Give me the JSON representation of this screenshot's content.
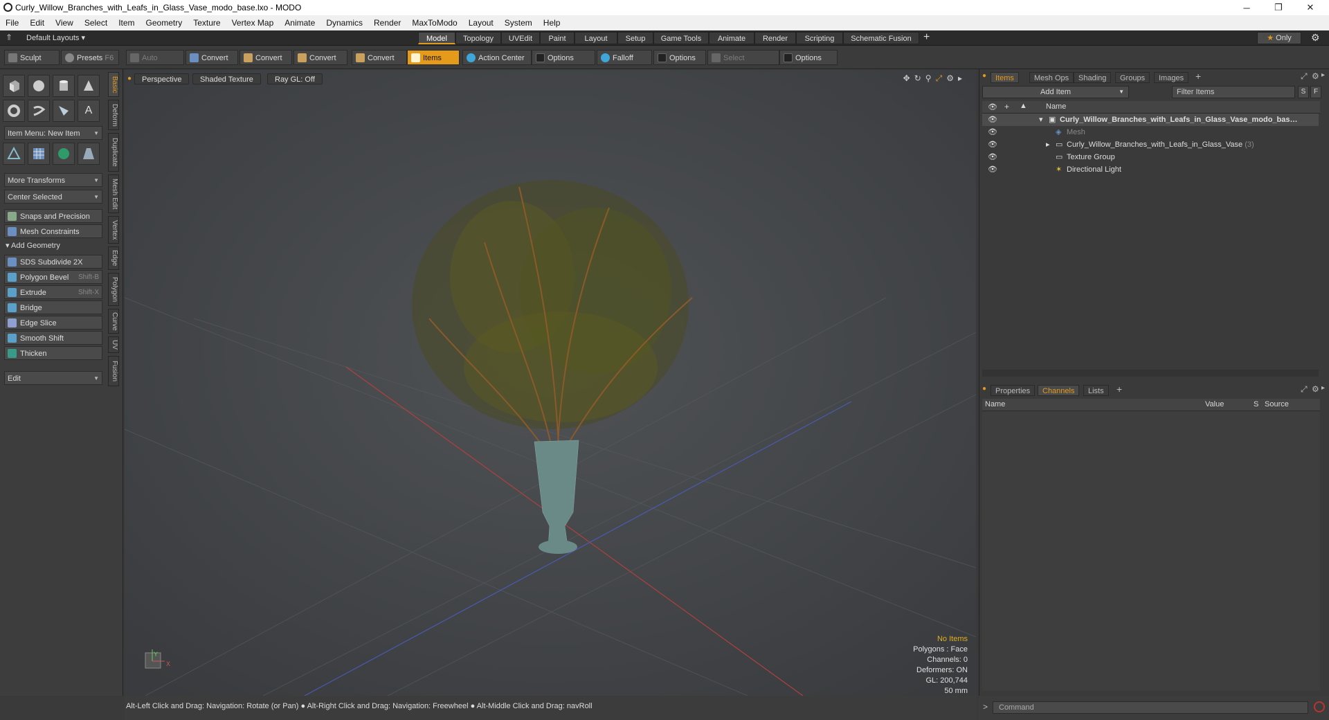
{
  "window": {
    "title": "Curly_Willow_Branches_with_Leafs_in_Glass_Vase_modo_base.lxo - MODO"
  },
  "menu": [
    "File",
    "Edit",
    "View",
    "Select",
    "Item",
    "Geometry",
    "Texture",
    "Vertex Map",
    "Animate",
    "Dynamics",
    "Render",
    "MaxToModo",
    "Layout",
    "System",
    "Help"
  ],
  "layout_selector": "Default Layouts",
  "mode_tabs": [
    "Model",
    "Topology",
    "UVEdit",
    "Paint",
    "Layout",
    "Setup",
    "Game Tools",
    "Animate",
    "Render",
    "Scripting",
    "Schematic Fusion"
  ],
  "mode_tab_active": "Model",
  "only_label": "Only",
  "toolbar": {
    "sculpt": "Sculpt",
    "presets": "Presets",
    "presets_key": "F6",
    "auto_select": "Auto Select",
    "convert1": "Convert",
    "convert2": "Convert",
    "convert3": "Convert",
    "convert4": "Convert",
    "items": "Items",
    "action_center": "Action Center",
    "options1": "Options",
    "falloff": "Falloff",
    "options2": "Options",
    "select_through": "Select Through",
    "options3": "Options"
  },
  "left_panel": {
    "item_menu": "Item Menu: New Item",
    "more_transforms": "More Transforms",
    "center_selected": "Center Selected",
    "snaps": "Snaps and Precision",
    "mesh_constraints": "Mesh Constraints",
    "add_geometry": "Add Geometry",
    "tools": [
      {
        "label": "SDS Subdivide 2X",
        "shortcut": ""
      },
      {
        "label": "Polygon Bevel",
        "shortcut": "Shift-B"
      },
      {
        "label": "Extrude",
        "shortcut": "Shift-X"
      },
      {
        "label": "Bridge",
        "shortcut": ""
      },
      {
        "label": "Edge Slice",
        "shortcut": ""
      },
      {
        "label": "Smooth Shift",
        "shortcut": ""
      },
      {
        "label": "Thicken",
        "shortcut": ""
      }
    ],
    "edit": "Edit"
  },
  "vertical_tabs": [
    "Basic",
    "Deform",
    "Duplicate",
    "Mesh Edit",
    "Vertex",
    "Edge",
    "Polygon",
    "Curve",
    "UV",
    "Fusion"
  ],
  "viewport": {
    "view": "Perspective",
    "shading": "Shaded Texture",
    "raygl": "Ray GL: Off",
    "info": {
      "items": "No Items",
      "polygons": "Polygons : Face",
      "channels": "Channels: 0",
      "deformers": "Deformers: ON",
      "gl": "GL: 200,744",
      "focal": "50 mm"
    },
    "axis_y": "Y",
    "axis_x": "X"
  },
  "status": "Alt-Left Click and Drag: Navigation: Rotate (or Pan) ● Alt-Right Click and Drag: Navigation: Freewheel ● Alt-Middle Click and Drag: navRoll",
  "items_panel": {
    "tabs": [
      "Items",
      "Mesh Ops",
      "Shading",
      "Groups",
      "Images"
    ],
    "add_item": "Add Item",
    "filter": "Filter Items",
    "s": "S",
    "f": "F",
    "name_col": "Name",
    "rows": [
      {
        "label": "Curly_Willow_Branches_with_Leafs_in_Glass_Vase_modo_bas…",
        "count": ""
      },
      {
        "label": "Mesh",
        "count": ""
      },
      {
        "label": "Curly_Willow_Branches_with_Leafs_in_Glass_Vase",
        "count": "(3)"
      },
      {
        "label": "Texture Group",
        "count": ""
      },
      {
        "label": "Directional Light",
        "count": ""
      }
    ]
  },
  "channels_panel": {
    "tabs": [
      "Properties",
      "Channels",
      "Lists"
    ],
    "cols": [
      "Name",
      "Value",
      "S",
      "Source"
    ]
  },
  "command_placeholder": "Command",
  "colors": {
    "accent": "#e59a1a",
    "bg": "#3a3a3a"
  }
}
